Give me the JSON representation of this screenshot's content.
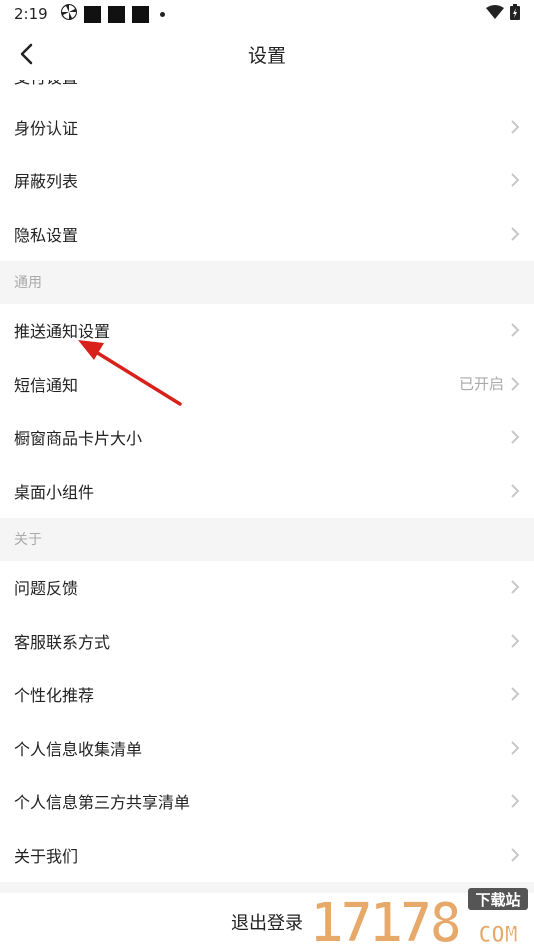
{
  "status_bar": {
    "time": "2:19"
  },
  "header": {
    "title": "设置"
  },
  "account_section": {
    "partial_item": "支付设置",
    "items": [
      {
        "label": "身份认证"
      },
      {
        "label": "屏蔽列表"
      },
      {
        "label": "隐私设置"
      }
    ]
  },
  "general_section": {
    "title": "通用",
    "items": [
      {
        "label": "推送通知设置",
        "value": ""
      },
      {
        "label": "短信通知",
        "value": "已开启"
      },
      {
        "label": "橱窗商品卡片大小",
        "value": ""
      },
      {
        "label": "桌面小组件",
        "value": ""
      }
    ]
  },
  "about_section": {
    "title": "关于",
    "items": [
      {
        "label": "问题反馈"
      },
      {
        "label": "客服联系方式"
      },
      {
        "label": "个性化推荐"
      },
      {
        "label": "个人信息收集清单"
      },
      {
        "label": "个人信息第三方共享清单"
      },
      {
        "label": "关于我们"
      }
    ]
  },
  "logout_label": "退出登录",
  "watermark": {
    "digits": "17178",
    "tag": "下载站",
    "suffix": "COM"
  },
  "colors": {
    "annotation_arrow": "#d9211c",
    "watermark": "#e6a96a"
  }
}
